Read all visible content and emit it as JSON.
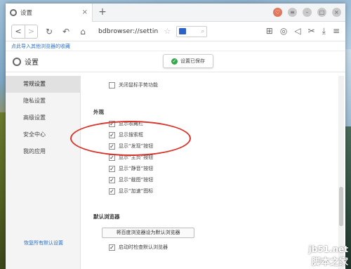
{
  "tab": {
    "label": "设置",
    "close": "×",
    "new_tab": "+"
  },
  "window_controls": [
    "♡",
    "≡",
    "–",
    "□",
    "×"
  ],
  "toolbar": {
    "back": "<",
    "forward": ">",
    "url": "bdbrowser://settin",
    "star": "☆",
    "search_icon": "⌕"
  },
  "bookmark_bar": {
    "import_link": "点此导入其他浏览器的收藏"
  },
  "settings_header": {
    "title": "设置",
    "toast": "设置已保存"
  },
  "sidebar": {
    "items": [
      {
        "label": "常规设置",
        "active": true
      },
      {
        "label": "隐私设置",
        "active": false
      },
      {
        "label": "高级设置",
        "active": false
      },
      {
        "label": "安全中心",
        "active": false
      },
      {
        "label": "我的应用",
        "active": false
      }
    ],
    "restore_link": "恢复所有默认设置"
  },
  "main": {
    "close_mouse_gesture": {
      "label": "关闭鼠标手势功能",
      "checked": false
    },
    "appearance": {
      "title": "外观",
      "options": [
        {
          "label": "显示收藏栏",
          "checked": true
        },
        {
          "label": "显示搜索框",
          "checked": true
        },
        {
          "label": "显示“发现”按钮",
          "checked": true
        },
        {
          "label": "显示“主页”按钮",
          "checked": true
        },
        {
          "label": "显示“静音”按钮",
          "checked": true
        },
        {
          "label": "显示“截图”按钮",
          "checked": true
        },
        {
          "label": "显示“加速”图标",
          "checked": true
        }
      ]
    },
    "default_browser": {
      "title": "默认浏览器",
      "button": "将百度浏览器设为默认浏览器",
      "check_on_start": {
        "label": "启动时检查默认浏览器",
        "checked": true
      }
    }
  },
  "watermark": {
    "line1": "jb51.net",
    "line2": "脚本之家"
  },
  "colors": {
    "link": "#2b73c9",
    "annotation": "#d9342b",
    "toast_ok": "#37a64d"
  }
}
